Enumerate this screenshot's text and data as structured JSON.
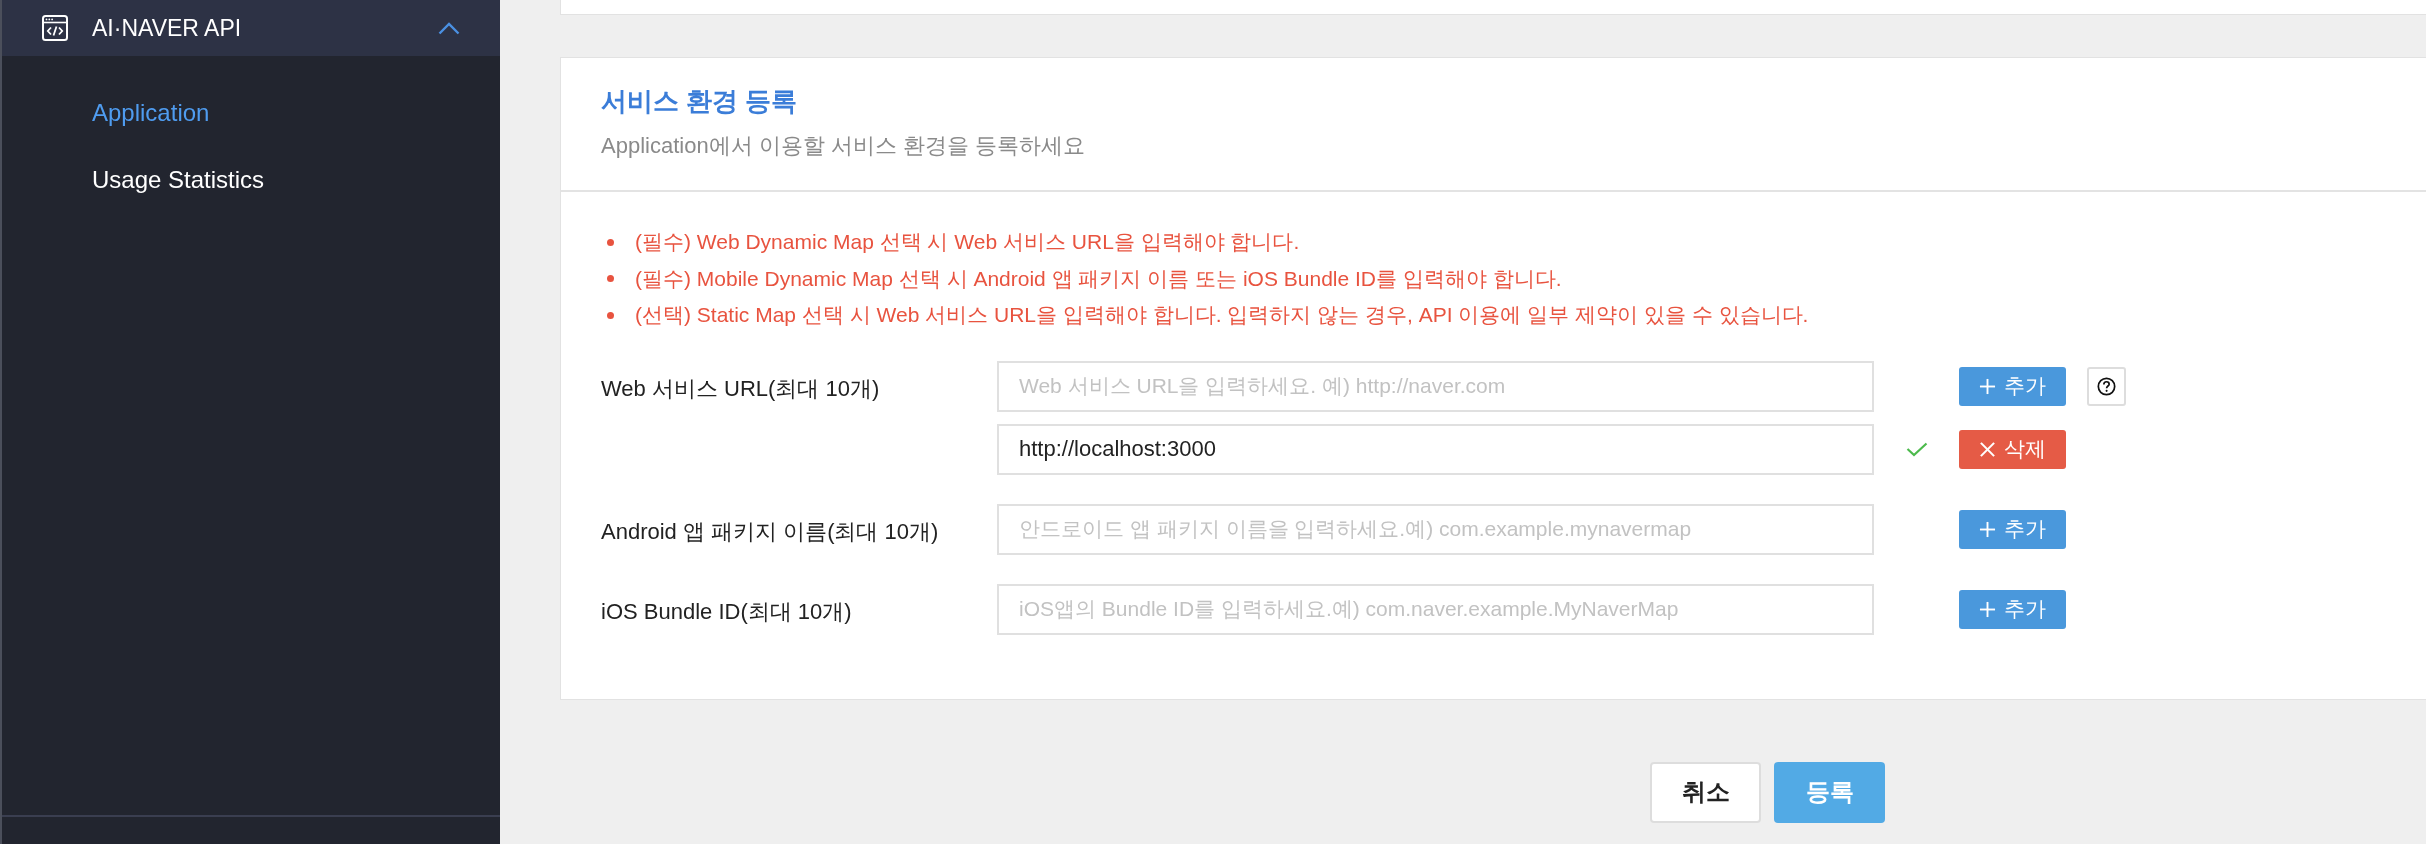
{
  "sidebar": {
    "section": {
      "title": "AI·NAVER API",
      "expanded": true
    },
    "items": [
      {
        "label": "Application",
        "selected": true
      },
      {
        "label": "Usage Statistics",
        "selected": false
      }
    ]
  },
  "card": {
    "title": "서비스 환경 등록",
    "subtitle": "Application에서 이용할 서비스 환경을 등록하세요",
    "notices": [
      "(필수) Web Dynamic Map 선택 시 Web 서비스 URL을 입력해야 합니다.",
      "(필수) Mobile Dynamic Map 선택 시 Android 앱 패키지 이름 또는 iOS Bundle ID를 입력해야 합니다.",
      "(선택) Static Map 선택 시 Web 서비스 URL을 입력해야 합니다. 입력하지 않는 경우, API 이용에 일부 제약이 있을 수 있습니다."
    ],
    "fields": [
      {
        "label": "Web 서비스 URL(최대 10개)",
        "help": true,
        "entries": [
          {
            "placeholder": "Web 서비스 URL을 입력하세요. 예) http://naver.com",
            "action": {
              "kind": "add",
              "label": "추가",
              "disabled": true
            }
          },
          {
            "value": "http://localhost:3000",
            "valid": true,
            "action": {
              "kind": "delete",
              "label": "삭제",
              "disabled": false
            }
          }
        ]
      },
      {
        "label": "Android 앱 패키지 이름(최대 10개)",
        "help": false,
        "entries": [
          {
            "placeholder": "안드로이드 앱 패키지 이름을 입력하세요.예) com.example.mynavermap",
            "action": {
              "kind": "add",
              "label": "추가",
              "disabled": true
            }
          }
        ]
      },
      {
        "label": "iOS Bundle ID(최대 10개)",
        "help": false,
        "entries": [
          {
            "placeholder": "iOS앱의 Bundle ID를 입력하세요.예) com.naver.example.MyNaverMap",
            "action": {
              "kind": "add",
              "label": "추가",
              "disabled": true
            }
          }
        ]
      }
    ]
  },
  "buttons": [
    {
      "label": "취소",
      "kind": "secondary"
    },
    {
      "label": "등록",
      "kind": "primary"
    }
  ]
}
